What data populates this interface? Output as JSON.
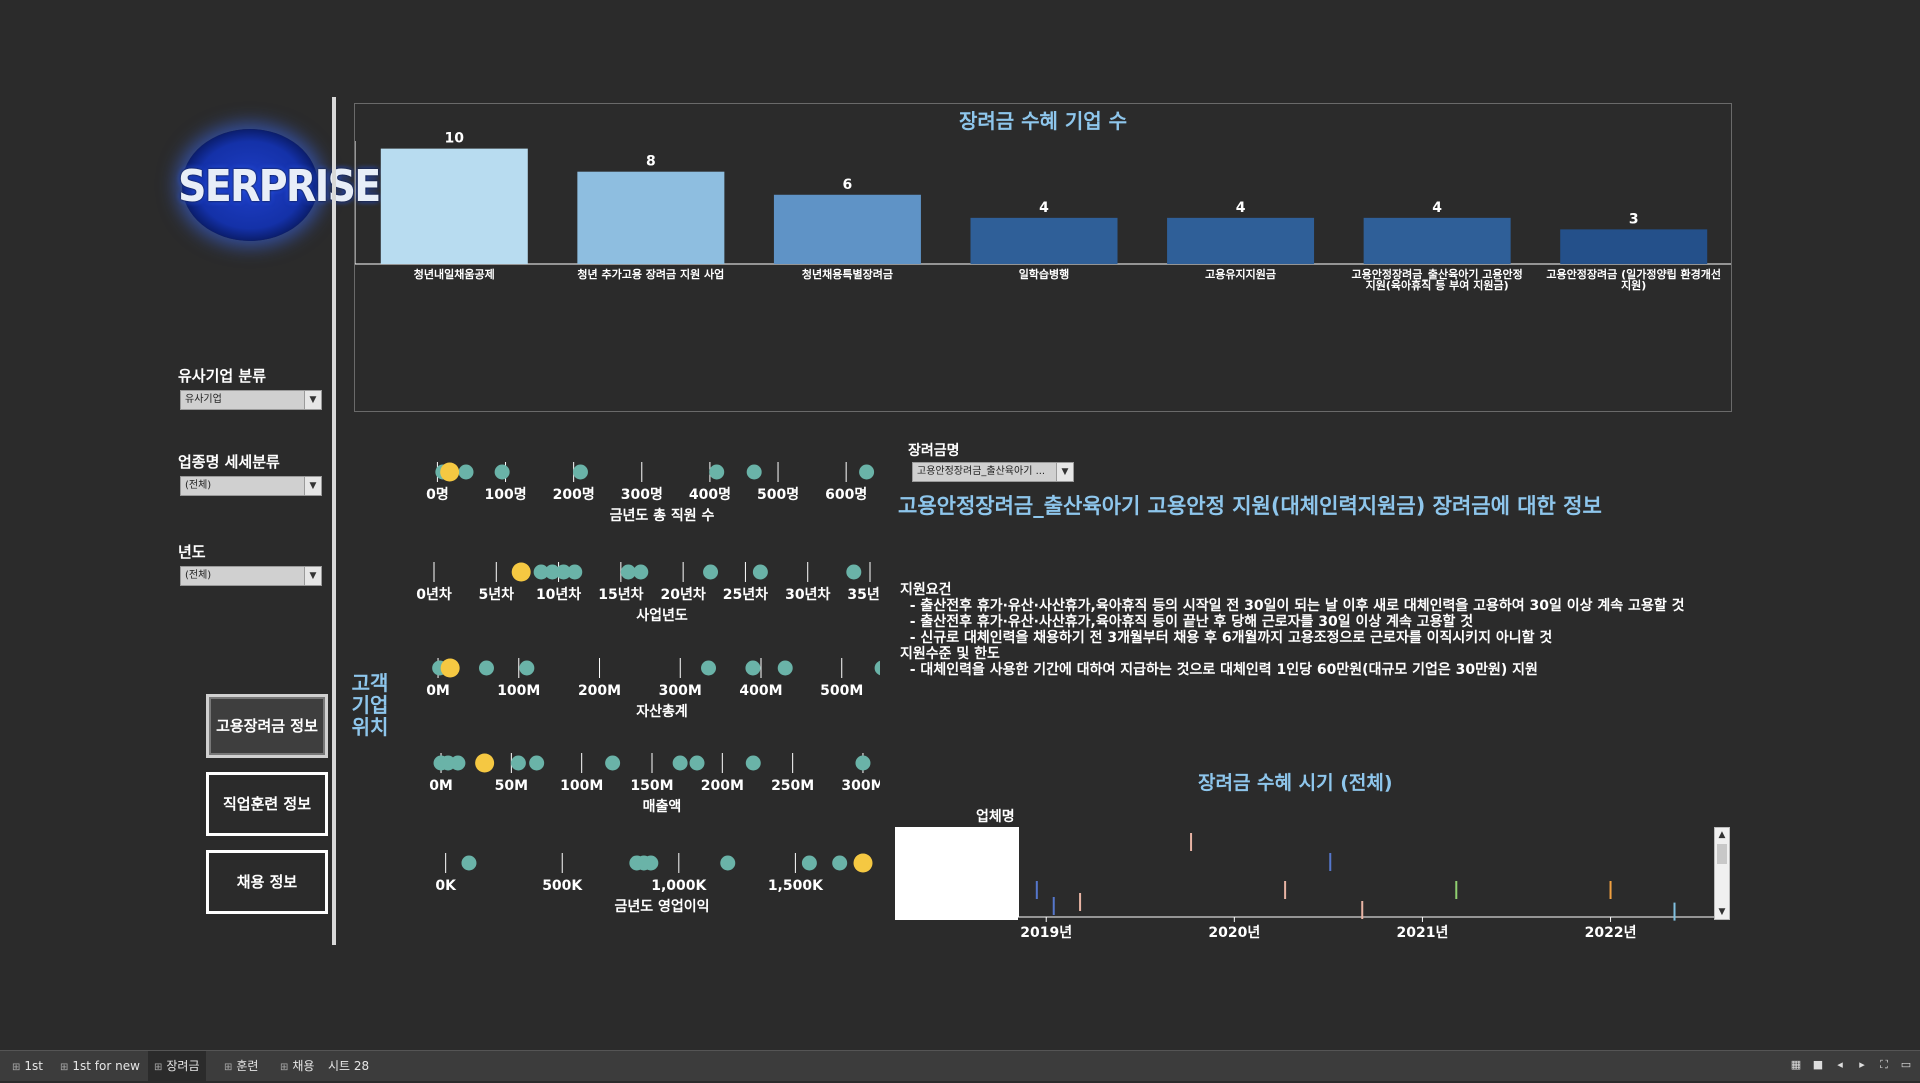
{
  "logo": {
    "text": "SERPRISE"
  },
  "filters": [
    {
      "label": "유사기업 분류",
      "value": "유사기업"
    },
    {
      "label": "업종명 세세분류",
      "value": "(전체)"
    },
    {
      "label": "년도",
      "value": "(전체)"
    }
  ],
  "nav": [
    {
      "label": "고용장려금 정보",
      "active": true
    },
    {
      "label": "직업훈련 정보",
      "active": false
    },
    {
      "label": "채용 정보",
      "active": false
    }
  ],
  "side_label": "고객\n기업\n위치",
  "chart_data": [
    {
      "type": "bar",
      "title": "장려금 수혜 기업 수",
      "categories": [
        "청년내일채움공제",
        "청년 추가고용 장려금 지원 사업",
        "청년채용특별장려금",
        "일학습병행",
        "고용유지지원금",
        "고용안정장려금_출산육아기 고용안정 지원(육아휴직 등 부여 지원금)",
        "고용안정장려금 (일가정양립 환경개선 지원)"
      ],
      "category_lines": [
        [
          "청년내일채움공제"
        ],
        [
          "청년 추가고용 장려금 지원 사업"
        ],
        [
          "청년채용특별장려금"
        ],
        [
          "일학습병행"
        ],
        [
          "고용유지지원금"
        ],
        [
          "고용안정장려금_출산육아기 고용안정",
          "지원(육아휴직 등 부여 지원금)"
        ],
        [
          "고용안정장려금 (일가정양립 환경개선",
          "지원)"
        ]
      ],
      "values": [
        10,
        8,
        6,
        4,
        4,
        4,
        3
      ],
      "colors": [
        "#b8dcf0",
        "#8ebee0",
        "#5f93c6",
        "#2f5f98",
        "#2f5f98",
        "#2f5f98",
        "#24508a"
      ],
      "ylim": [
        0,
        13
      ]
    },
    {
      "type": "scatter",
      "xlabel": "금년도 총 직원 수",
      "ticks": [
        0,
        100,
        200,
        300,
        400,
        500,
        600
      ],
      "tick_labels": [
        "0명",
        "100명",
        "200명",
        "300명",
        "400명",
        "500명",
        "600명"
      ],
      "xlim": [
        -5,
        635
      ],
      "values": [
        8,
        42,
        95,
        210,
        410,
        465,
        630
      ],
      "highlight": 18
    },
    {
      "type": "scatter",
      "xlabel": "사업년도",
      "ticks": [
        0,
        5,
        10,
        15,
        20,
        25,
        30,
        35
      ],
      "tick_labels": [
        "0년차",
        "5년차",
        "10년차",
        "15년차",
        "20년차",
        "25년차",
        "30년차",
        "35년차"
      ],
      "xlim": [
        0,
        35
      ],
      "values": [
        8.6,
        9.5,
        10.4,
        11.3,
        15.6,
        16.6,
        22.2,
        26.2,
        33.7
      ],
      "highlight": 7
    },
    {
      "type": "scatter",
      "xlabel": "자산총계",
      "ticks": [
        0,
        100,
        200,
        300,
        400,
        500
      ],
      "tick_labels": [
        "0M",
        "100M",
        "200M",
        "300M",
        "400M",
        "500M"
      ],
      "xlim": [
        -5,
        535
      ],
      "values": [
        2,
        60,
        110,
        335,
        390,
        430,
        550
      ],
      "highlight": 15
    },
    {
      "type": "scatter",
      "xlabel": "매출액",
      "ticks": [
        0,
        50,
        100,
        150,
        200,
        250,
        300
      ],
      "tick_labels": [
        "0M",
        "50M",
        "100M",
        "150M",
        "200M",
        "250M",
        "300M"
      ],
      "xlim": [
        -5,
        305
      ],
      "values": [
        0,
        5,
        12,
        55,
        68,
        122,
        170,
        182,
        222,
        300
      ],
      "highlight": 31
    },
    {
      "type": "scatter",
      "xlabel": "금년도 영업이익",
      "ticks": [
        0,
        500,
        1000,
        1500
      ],
      "tick_labels": [
        "0K",
        "500K",
        "1,000K",
        "1,500K"
      ],
      "xlim": [
        -50,
        1820
      ],
      "values": [
        100,
        820,
        850,
        880,
        1210,
        1560,
        1690
      ],
      "highlight": 1790
    },
    {
      "type": "timeline",
      "title": "장려금 수혜 시기 (전체)",
      "column_header": "업체명",
      "tick_labels": [
        "2019년",
        "2020년",
        "2021년",
        "2022년"
      ],
      "ticks": [
        2019,
        2020,
        2021,
        2022
      ],
      "xlim": [
        2018.85,
        2022.55
      ],
      "events": [
        {
          "x": 2018.95,
          "row": 0.7,
          "color": "#5577cc"
        },
        {
          "x": 2019.04,
          "row": 0.9,
          "color": "#5577cc"
        },
        {
          "x": 2019.18,
          "row": 0.85,
          "color": "#e8b4a4"
        },
        {
          "x": 2019.77,
          "row": 0.1,
          "color": "#e8b4a4"
        },
        {
          "x": 2020.27,
          "row": 0.7,
          "color": "#e8b4a4"
        },
        {
          "x": 2020.51,
          "row": 0.35,
          "color": "#5577cc"
        },
        {
          "x": 2020.68,
          "row": 0.95,
          "color": "#e8b4a4"
        },
        {
          "x": 2021.18,
          "row": 0.7,
          "color": "#90d070"
        },
        {
          "x": 2022.0,
          "row": 0.7,
          "color": "#f0a040"
        },
        {
          "x": 2022.34,
          "row": 0.97,
          "color": "#80c0e0"
        }
      ]
    }
  ],
  "info": {
    "dropdown_label": "장려금명",
    "dropdown_value": "고용안정장려금_출산육아기 ...",
    "title": "고용안정장려금_출산육아기 고용안정 지원(대체인력지원금) 장려금에 대한 정보",
    "lines": [
      "지원요건",
      "  - 출산전후 휴가·유산·사산휴가,육아휴직 등의 시작일 전 30일이 되는 날 이후 새로 대체인력을 고용하여 30일 이상 계속 고용할 것",
      "  - 출산전후 휴가·유산·사산휴가,육아휴직 등이 끝난 후 당해 근로자를 30일 이상 계속 고용할 것",
      "  - 신규로 대체인력을 채용하기 전 3개월부터 채용 후 6개월까지 고용조정으로 근로자를 이직시키지 아니할 것",
      "지원수준 및 한도",
      "  - 대체인력을 사용한 기간에 대하여 지급하는 것으로 대체인력 1인당 60만원(대규모 기업은 30만원) 지원"
    ]
  },
  "colors": {
    "dot": "#6ab3a8",
    "highlight": "#f5c842",
    "title_blue": "#8ec6ec"
  },
  "statusbar": {
    "tabs": [
      {
        "label": "1st",
        "icon": "grid-icon"
      },
      {
        "label": "1st for new",
        "icon": "grid-icon"
      },
      {
        "label": "장려금",
        "icon": "grid-icon",
        "active": true
      },
      {
        "label": "훈련",
        "icon": "grid-icon"
      },
      {
        "label": "채용",
        "icon": "grid-icon"
      },
      {
        "label": "시트 28",
        "icon": ""
      }
    ]
  }
}
